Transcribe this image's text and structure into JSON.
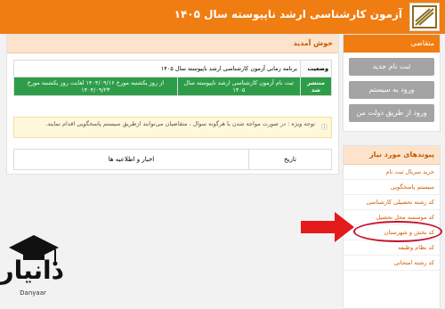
{
  "header": {
    "title": "آزمون کارشناسی ارشد ناپیوسته سال ۱۴۰۵",
    "bg_color": "#f07d12"
  },
  "applicant_panel": {
    "title": "متقاضی",
    "buttons": [
      "ثبت نام جدید",
      "ورود به سیستم",
      "ورود از طریق دولت من"
    ]
  },
  "links_panel": {
    "title": "پیوندهای مورد نیاز",
    "items": [
      "خرید سریال ثبت نام",
      "سیستم پاسخگویی",
      "کد رشته تحصیلی کارشناسی",
      "کد موسسه محل تحصیل",
      "کد بخش و شهرستان",
      "کد نظام وظیفه",
      "کد رشته امتحانی"
    ]
  },
  "welcome_panel": {
    "title": "خوش آمدید",
    "status_table": {
      "row1": {
        "label": "وضعیت",
        "value": "برنامه زمانی آزمون کارشناسی ارشد ناپیوسته سال ۱۴۰۵"
      },
      "row2": {
        "label": "منتشر شد",
        "value1": "ثبت نام آزمون کارشناسی ارشد ناپیوسته سال ۱۴۰۵",
        "value2": "از روز یکشنبه مورخ ۱۴۰۴/۰۹/۱۶ لغایت روز یکشنبه مورخ ۱۴۰۴/۰۹/۲۳"
      }
    },
    "note": "توجه ویژه : در صورت مواجه شدن با هرگونه سوال ، متقاضیان می‌توانند ازطریق سیستم پاسخگویی اقدام نمایند.",
    "news_table": {
      "col_date": "تاریخ",
      "col_news": "اخبار و اطلاعیه ها"
    }
  },
  "watermark": {
    "text": "دانیار",
    "sub": "Danyaar"
  },
  "colors": {
    "accent": "#f07d12",
    "green": "#2e9d49",
    "highlight": "#c8102e"
  }
}
